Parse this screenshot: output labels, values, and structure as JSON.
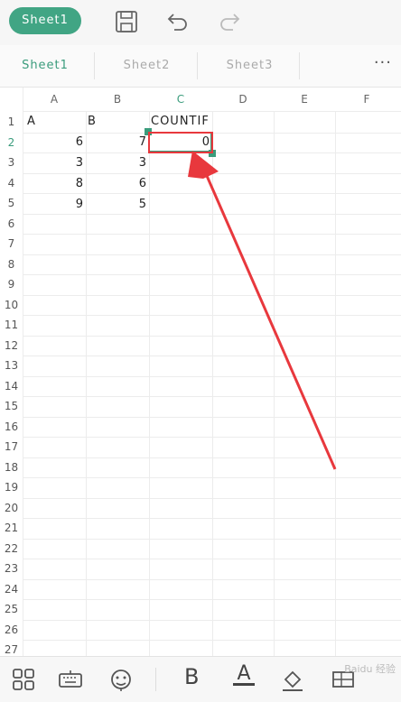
{
  "toolbar": {
    "sheet_button": "Sheet1",
    "icons": [
      "save-icon",
      "undo-icon",
      "redo-icon"
    ]
  },
  "tabs": [
    {
      "label": "Sheet1",
      "active": true
    },
    {
      "label": "Sheet2",
      "active": false
    },
    {
      "label": "Sheet3",
      "active": false
    }
  ],
  "more": "···",
  "columns": [
    "A",
    "B",
    "C",
    "D",
    "E",
    "F"
  ],
  "active_column": "C",
  "rows": [
    "1",
    "2",
    "3",
    "4",
    "5",
    "6",
    "7",
    "8",
    "9",
    "10",
    "11",
    "12",
    "13",
    "14",
    "15",
    "16",
    "17",
    "18",
    "19",
    "20",
    "21",
    "22",
    "23",
    "24",
    "25",
    "26",
    "27"
  ],
  "active_row": "2",
  "cells": {
    "A1": "A",
    "B1": "B",
    "C1": "COUNTIF",
    "A2": "6",
    "B2": "7",
    "C2": "0",
    "A3": "3",
    "B3": "3",
    "A4": "8",
    "B4": "6",
    "A5": "9",
    "B5": "5"
  },
  "selected_cell": "C2",
  "colors": {
    "accent": "#3a9c7c",
    "highlight": "#e8383d",
    "annotation_arrow": "#e8383d"
  },
  "bottom_toolbar": {
    "icons": [
      "grid-apps-icon",
      "keyboard-icon",
      "face-icon",
      "bold-icon",
      "font-color-icon",
      "fill-color-icon",
      "cell-format-icon"
    ],
    "bold_label": "B",
    "font_color_label": "A"
  },
  "watermark": "Baidu 经验"
}
